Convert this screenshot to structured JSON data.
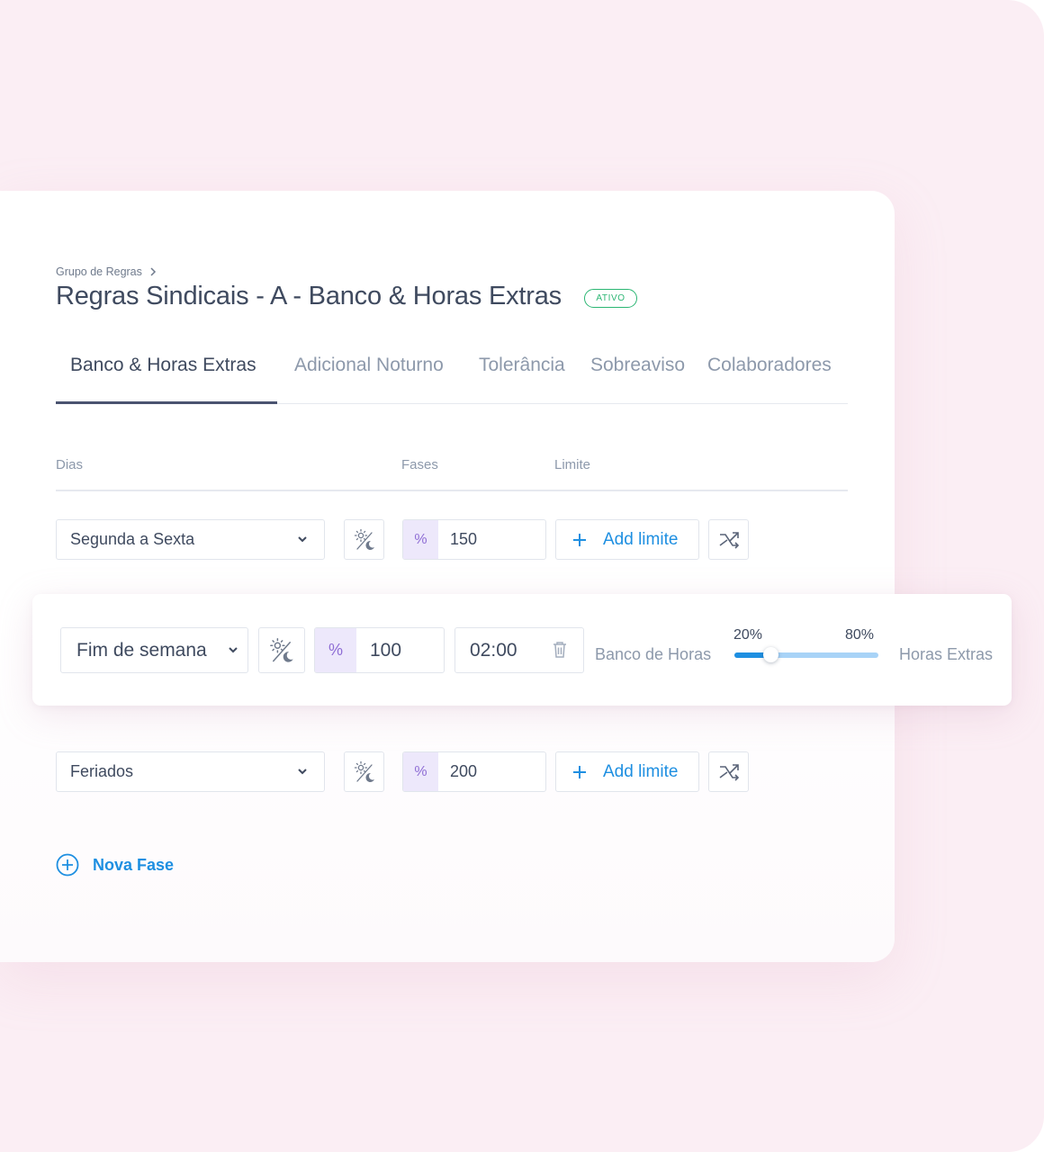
{
  "breadcrumb": {
    "label": "Grupo de Regras"
  },
  "page": {
    "title": "Regras Sindicais - A - Banco & Horas Extras",
    "status": "ATIVO"
  },
  "tabs": [
    {
      "label": "Banco & Horas Extras",
      "active": true
    },
    {
      "label": "Adicional Noturno",
      "active": false
    },
    {
      "label": "Tolerância",
      "active": false
    },
    {
      "label": "Sobreaviso",
      "active": false
    },
    {
      "label": "Colaboradores",
      "active": false
    }
  ],
  "columns": {
    "dias": "Dias",
    "fases": "Fases",
    "limite": "Limite"
  },
  "rows": [
    {
      "dias": "Segunda a Sexta",
      "percent_symbol": "%",
      "percent": "150",
      "add_limit": "Add limite"
    },
    {
      "dias": "Fim de semana",
      "percent_symbol": "%",
      "percent": "100",
      "limit_time": "02:00"
    },
    {
      "dias": "Feriados",
      "percent_symbol": "%",
      "percent": "200",
      "add_limit": "Add limite"
    }
  ],
  "split": {
    "left_label": "Banco de Horas",
    "right_label": "Horas Extras",
    "left_percent": "20%",
    "right_percent": "80%",
    "value": 0.25
  },
  "actions": {
    "nova_fase": "Nova Fase"
  },
  "colors": {
    "accent": "#1e8fe1",
    "status_active": "#2bb673",
    "percent_bg": "#ede8fb",
    "percent_text": "#8f6ed5",
    "background": "#fbeef4"
  },
  "icons": {
    "breadcrumb": "chevron-right-icon",
    "day_night": "sun-moon-icon",
    "split": "split-arrow-icon",
    "delete": "trash-icon",
    "add": "plus-icon",
    "dropdown": "chevron-down-icon"
  }
}
